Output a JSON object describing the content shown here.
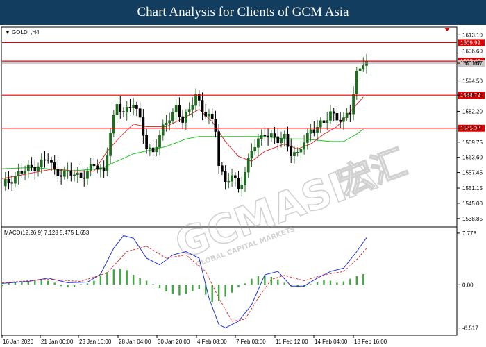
{
  "page": {
    "title": "Chart Analysis for Clients of GCM Asia"
  },
  "watermark": {
    "brand": "GCMASIA",
    "cn": "宏汇",
    "sub": "GLOBAL CAPITAL MARKETS"
  },
  "colors": {
    "bull": "#1f6b1f",
    "bear": "#000000",
    "level_line": "#e00000",
    "ma_fast": "#e03030",
    "ma_slow": "#22c422",
    "macd_line": "#1f2fd6",
    "macd_signal": "#e03030",
    "macd_hist": "#3fa83f",
    "level_label_bg": "#e00000",
    "price_label_bg": "#c8c8c8"
  },
  "chart_data": [
    {
      "type": "candlestick",
      "symbol_label": "GOLD_,H4",
      "ylim": [
        1536.0,
        1616.0
      ],
      "y_ticks": [
        "1613.10",
        "1606.60",
        "1601.67",
        "1594.50",
        "1588.72",
        "1582.20",
        "1575.37",
        "1569.75",
        "1563.60",
        "1557.45",
        "1551.15",
        "1545.00",
        "1538.85"
      ],
      "x_ticks": [
        "16 Jan 2020",
        "21 Jan 00:00",
        "23 Jan 16:00",
        "28 Jan 04:00",
        "30 Jan 20:00",
        "4 Feb 08:00",
        "7 Feb 00:00",
        "11 Feb 12:00",
        "14 Feb 04:00",
        "18 Feb 16:00"
      ],
      "levels": [
        {
          "value": 1609.99,
          "label": "1609.99"
        },
        {
          "value": 1602.49,
          "label": "1602.49"
        },
        {
          "value": 1588.72,
          "label": "1588.72"
        },
        {
          "value": 1575.37,
          "label": "1575.37"
        }
      ],
      "current_price": {
        "value": 1601.67,
        "label": "1601.67"
      },
      "ohlc_close_path": [
        [
          0,
          1552
        ],
        [
          5,
          1557
        ],
        [
          10,
          1560
        ],
        [
          14,
          1563
        ],
        [
          16,
          1558
        ],
        [
          20,
          1557
        ],
        [
          24,
          1556
        ],
        [
          28,
          1560
        ],
        [
          31,
          1558
        ],
        [
          33,
          1574
        ],
        [
          35,
          1584
        ],
        [
          37,
          1582
        ],
        [
          40,
          1586
        ],
        [
          42,
          1578
        ],
        [
          44,
          1568
        ],
        [
          46,
          1566
        ],
        [
          48,
          1572
        ],
        [
          51,
          1580
        ],
        [
          53,
          1584
        ],
        [
          55,
          1578
        ],
        [
          57,
          1582
        ],
        [
          59,
          1590
        ],
        [
          61,
          1582
        ],
        [
          63,
          1580
        ],
        [
          65,
          1575
        ],
        [
          66,
          1562
        ],
        [
          68,
          1553
        ],
        [
          70,
          1556
        ],
        [
          72,
          1551
        ],
        [
          74,
          1558
        ],
        [
          76,
          1566
        ],
        [
          78,
          1570
        ],
        [
          80,
          1574
        ],
        [
          82,
          1572
        ],
        [
          84,
          1570
        ],
        [
          86,
          1572
        ],
        [
          88,
          1566
        ],
        [
          90,
          1564
        ],
        [
          92,
          1570
        ],
        [
          94,
          1575
        ],
        [
          96,
          1576
        ],
        [
          98,
          1577
        ],
        [
          100,
          1582
        ],
        [
          102,
          1580
        ],
        [
          104,
          1578
        ],
        [
          106,
          1582
        ],
        [
          107,
          1590
        ],
        [
          108,
          1598
        ],
        [
          110,
          1602
        ],
        [
          111,
          1601.67
        ]
      ],
      "ma_fast": [
        [
          0,
          1555
        ],
        [
          8,
          1557
        ],
        [
          16,
          1559
        ],
        [
          22,
          1558
        ],
        [
          28,
          1558
        ],
        [
          32,
          1566
        ],
        [
          36,
          1572
        ],
        [
          40,
          1577
        ],
        [
          44,
          1576
        ],
        [
          50,
          1576
        ],
        [
          56,
          1580
        ],
        [
          60,
          1583
        ],
        [
          64,
          1578
        ],
        [
          68,
          1570
        ],
        [
          72,
          1564
        ],
        [
          76,
          1562
        ],
        [
          80,
          1566
        ],
        [
          86,
          1569
        ],
        [
          90,
          1567
        ],
        [
          94,
          1569
        ],
        [
          98,
          1573
        ],
        [
          102,
          1576
        ],
        [
          106,
          1582
        ],
        [
          110,
          1588
        ]
      ],
      "ma_slow": [
        [
          0,
          1559
        ],
        [
          10,
          1559.5
        ],
        [
          20,
          1558
        ],
        [
          30,
          1559
        ],
        [
          40,
          1565
        ],
        [
          50,
          1568
        ],
        [
          56,
          1571
        ],
        [
          60,
          1572
        ],
        [
          70,
          1572
        ],
        [
          80,
          1572
        ],
        [
          86,
          1571
        ],
        [
          92,
          1571
        ],
        [
          100,
          1570
        ],
        [
          104,
          1570
        ],
        [
          108,
          1573
        ],
        [
          110,
          1575
        ]
      ]
    },
    {
      "type": "line",
      "label": "MACD(12,26,9) 7.128 5.475 1.653",
      "ylim": [
        -7.5,
        8.5
      ],
      "y_ticks": [
        "7.778",
        "0.00",
        "-6.517"
      ],
      "macd": [
        [
          0,
          0.2
        ],
        [
          8,
          0.5
        ],
        [
          14,
          1.0
        ],
        [
          20,
          0.3
        ],
        [
          26,
          0.4
        ],
        [
          30,
          1.6
        ],
        [
          34,
          5.5
        ],
        [
          37,
          7.4
        ],
        [
          40,
          7.0
        ],
        [
          44,
          4.0
        ],
        [
          48,
          3.0
        ],
        [
          52,
          4.5
        ],
        [
          56,
          5.0
        ],
        [
          60,
          4.0
        ],
        [
          63,
          -2.0
        ],
        [
          66,
          -6.0
        ],
        [
          68,
          -6.5
        ],
        [
          72,
          -5.5
        ],
        [
          76,
          -3.0
        ],
        [
          80,
          1.5
        ],
        [
          84,
          2.0
        ],
        [
          88,
          -0.2
        ],
        [
          92,
          -0.2
        ],
        [
          96,
          1.0
        ],
        [
          100,
          2.0
        ],
        [
          104,
          2.5
        ],
        [
          108,
          5.0
        ],
        [
          111,
          7.1
        ]
      ],
      "signal": [
        [
          0,
          0.3
        ],
        [
          14,
          0.8
        ],
        [
          24,
          0.5
        ],
        [
          32,
          1.8
        ],
        [
          38,
          5.0
        ],
        [
          44,
          5.8
        ],
        [
          50,
          4.0
        ],
        [
          56,
          4.5
        ],
        [
          62,
          2.0
        ],
        [
          66,
          -2.0
        ],
        [
          70,
          -5.5
        ],
        [
          74,
          -5.2
        ],
        [
          78,
          -2.0
        ],
        [
          82,
          0.8
        ],
        [
          86,
          1.4
        ],
        [
          92,
          0.6
        ],
        [
          98,
          1.5
        ],
        [
          104,
          2.0
        ],
        [
          108,
          3.8
        ],
        [
          111,
          5.5
        ]
      ],
      "histogram": [
        [
          0,
          -0.2
        ],
        [
          2,
          0.3
        ],
        [
          4,
          0.4
        ],
        [
          6,
          0.5
        ],
        [
          8,
          0.4
        ],
        [
          10,
          0.6
        ],
        [
          12,
          0.7
        ],
        [
          14,
          0.6
        ],
        [
          16,
          0.3
        ],
        [
          18,
          -0.2
        ],
        [
          20,
          -0.4
        ],
        [
          22,
          -0.3
        ],
        [
          24,
          0.1
        ],
        [
          26,
          0.2
        ],
        [
          28,
          0.6
        ],
        [
          30,
          1.4
        ],
        [
          32,
          1.9
        ],
        [
          34,
          2.3
        ],
        [
          36,
          2.4
        ],
        [
          38,
          2.2
        ],
        [
          40,
          1.5
        ],
        [
          42,
          1.0
        ],
        [
          44,
          0.6
        ],
        [
          46,
          0.1
        ],
        [
          48,
          -0.5
        ],
        [
          50,
          -1.0
        ],
        [
          52,
          -1.4
        ],
        [
          54,
          -1.6
        ],
        [
          56,
          -1.4
        ],
        [
          58,
          -1.0
        ],
        [
          60,
          -0.6
        ],
        [
          62,
          -1.5
        ],
        [
          64,
          -2.6
        ],
        [
          66,
          -2.4
        ],
        [
          68,
          -1.8
        ],
        [
          70,
          -1.2
        ],
        [
          72,
          -0.4
        ],
        [
          74,
          0.2
        ],
        [
          76,
          0.9
        ],
        [
          78,
          1.3
        ],
        [
          80,
          1.4
        ],
        [
          82,
          1.2
        ],
        [
          84,
          0.8
        ],
        [
          86,
          0.3
        ],
        [
          88,
          -0.2
        ],
        [
          90,
          -0.4
        ],
        [
          92,
          -0.3
        ],
        [
          94,
          0.1
        ],
        [
          96,
          0.4
        ],
        [
          98,
          0.7
        ],
        [
          100,
          0.6
        ],
        [
          102,
          0.3
        ],
        [
          104,
          0.5
        ],
        [
          106,
          0.9
        ],
        [
          108,
          1.3
        ],
        [
          110,
          1.6
        ]
      ]
    }
  ]
}
